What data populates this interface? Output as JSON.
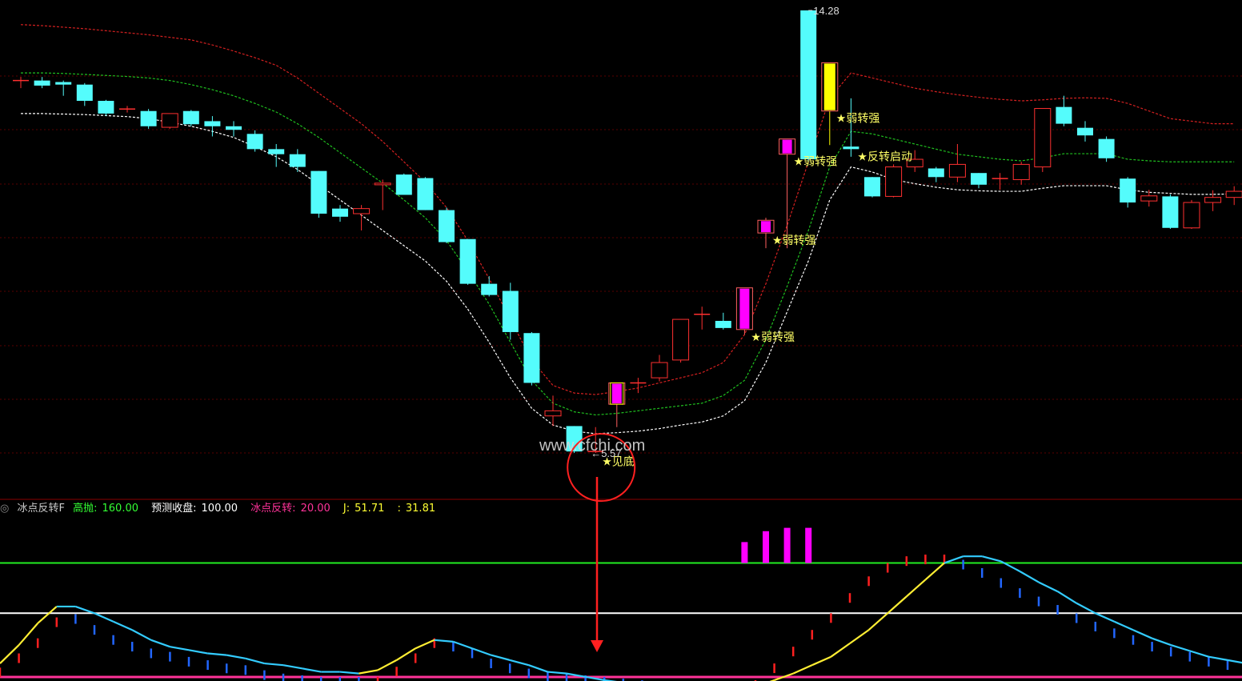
{
  "watermark": "www.cfchi.com",
  "indicator": {
    "name": "冰点反转F",
    "items": [
      {
        "label": "高抛:",
        "value": "160.00",
        "label_color": "#33ff33",
        "value_color": "#33ff33"
      },
      {
        "label": "预测收盘:",
        "value": "100.00",
        "label_color": "#ffffff",
        "value_color": "#ffffff"
      },
      {
        "label": "冰点反转:",
        "value": "20.00",
        "label_color": "#ff3399",
        "value_color": "#ff3399"
      },
      {
        "label": "J:",
        "value": "51.71",
        "label_color": "#ffff33",
        "value_color": "#ffff33"
      },
      {
        "label": ":",
        "value": "31.81",
        "label_color": "#ffff33",
        "value_color": "#ffff33"
      }
    ]
  },
  "colors": {
    "up": "#ff3030",
    "down": "#54fcfc",
    "signal": "#ff00ff",
    "yellow": "#ffff00",
    "env_red": "#d42020",
    "env_green": "#1fbf1f",
    "env_white": "#ffffff",
    "label": "#ffff66",
    "line_high": "#22ee22",
    "line_mid": "#ffffff",
    "line_low": "#ff3399",
    "j_down": "#33ccff",
    "j_up": "#ffee33"
  },
  "chart_data": {
    "type": "candlestick",
    "price_high_label": "14.28",
    "price_low_label": "5.57",
    "ylim": [
      5.0,
      14.5
    ],
    "candles": [
      {
        "o": 12.9,
        "h": 12.97,
        "l": 12.75,
        "c": 12.9,
        "t": "doji"
      },
      {
        "o": 12.9,
        "h": 12.97,
        "l": 12.75,
        "c": 12.8,
        "t": "down"
      },
      {
        "o": 12.87,
        "h": 12.9,
        "l": 12.6,
        "c": 12.82,
        "t": "down"
      },
      {
        "o": 12.82,
        "h": 12.85,
        "l": 12.4,
        "c": 12.5,
        "t": "down"
      },
      {
        "o": 12.5,
        "h": 12.52,
        "l": 12.2,
        "c": 12.25,
        "t": "down"
      },
      {
        "o": 12.34,
        "h": 12.4,
        "l": 12.27,
        "c": 12.34,
        "t": "doji"
      },
      {
        "o": 12.3,
        "h": 12.34,
        "l": 11.95,
        "c": 12.0,
        "t": "down"
      },
      {
        "o": 11.98,
        "h": 12.25,
        "l": 11.95,
        "c": 12.25,
        "t": "up"
      },
      {
        "o": 12.3,
        "h": 12.32,
        "l": 12.0,
        "c": 12.04,
        "t": "down"
      },
      {
        "o": 12.1,
        "h": 12.2,
        "l": 11.8,
        "c": 12.0,
        "t": "down"
      },
      {
        "o": 12.0,
        "h": 12.1,
        "l": 11.8,
        "c": 11.93,
        "t": "down"
      },
      {
        "o": 11.85,
        "h": 11.92,
        "l": 11.5,
        "c": 11.55,
        "t": "down"
      },
      {
        "o": 11.55,
        "h": 11.65,
        "l": 11.2,
        "c": 11.45,
        "t": "down"
      },
      {
        "o": 11.45,
        "h": 11.55,
        "l": 11.1,
        "c": 11.2,
        "t": "down"
      },
      {
        "o": 11.12,
        "h": 11.12,
        "l": 10.2,
        "c": 10.28,
        "t": "down"
      },
      {
        "o": 10.38,
        "h": 10.45,
        "l": 10.12,
        "c": 10.22,
        "t": "down"
      },
      {
        "o": 10.28,
        "h": 10.45,
        "l": 9.95,
        "c": 10.38,
        "t": "up"
      },
      {
        "o": 10.88,
        "h": 10.95,
        "l": 10.35,
        "c": 10.88,
        "t": "up"
      },
      {
        "o": 11.05,
        "h": 11.07,
        "l": 10.65,
        "c": 10.65,
        "t": "down"
      },
      {
        "o": 10.98,
        "h": 11.0,
        "l": 10.35,
        "c": 10.35,
        "t": "down"
      },
      {
        "o": 10.35,
        "h": 10.4,
        "l": 9.7,
        "c": 9.72,
        "t": "down"
      },
      {
        "o": 9.78,
        "h": 9.78,
        "l": 8.88,
        "c": 8.9,
        "t": "down"
      },
      {
        "o": 8.9,
        "h": 9.05,
        "l": 8.65,
        "c": 8.68,
        "t": "down"
      },
      {
        "o": 8.76,
        "h": 8.92,
        "l": 7.8,
        "c": 7.95,
        "t": "down"
      },
      {
        "o": 7.93,
        "h": 7.95,
        "l": 6.9,
        "c": 6.95,
        "t": "down"
      },
      {
        "o": 6.3,
        "h": 6.7,
        "l": 6.1,
        "c": 6.4,
        "t": "up"
      },
      {
        "o": 6.1,
        "h": 6.1,
        "l": 5.57,
        "c": 5.6,
        "t": "down"
      },
      {
        "o": 5.55,
        "h": 6.08,
        "l": 5.57,
        "c": 5.6,
        "t": "doji"
      },
      {
        "o": 6.53,
        "h": 6.95,
        "l": 6.08,
        "c": 6.95,
        "t": "signal"
      },
      {
        "o": 6.9,
        "h": 7.05,
        "l": 6.75,
        "c": 6.95,
        "t": "doji"
      },
      {
        "o": 7.05,
        "h": 7.5,
        "l": 6.98,
        "c": 7.35,
        "t": "up"
      },
      {
        "o": 7.4,
        "h": 8.2,
        "l": 7.35,
        "c": 8.2,
        "t": "up"
      },
      {
        "o": 8.3,
        "h": 8.45,
        "l": 8.0,
        "c": 8.3,
        "t": "doji"
      },
      {
        "o": 8.17,
        "h": 8.33,
        "l": 8.0,
        "c": 8.03,
        "t": "down"
      },
      {
        "o": 8.0,
        "h": 8.82,
        "l": 7.9,
        "c": 8.82,
        "t": "signal"
      },
      {
        "o": 9.9,
        "h": 10.2,
        "l": 9.6,
        "c": 10.15,
        "t": "signal"
      },
      {
        "o": 11.45,
        "h": 11.55,
        "l": 9.6,
        "c": 11.75,
        "t": "signal"
      },
      {
        "o": 14.28,
        "h": 14.28,
        "l": 11.3,
        "c": 11.35,
        "t": "down"
      },
      {
        "o": 12.3,
        "h": 13.25,
        "l": 11.63,
        "c": 13.25,
        "t": "yellow"
      },
      {
        "o": 11.55,
        "h": 12.55,
        "l": 11.4,
        "c": 11.6,
        "t": "down"
      },
      {
        "o": 11.0,
        "h": 11.0,
        "l": 10.6,
        "c": 10.62,
        "t": "down"
      },
      {
        "o": 10.62,
        "h": 11.25,
        "l": 10.6,
        "c": 11.2,
        "t": "up"
      },
      {
        "o": 11.2,
        "h": 11.53,
        "l": 11.1,
        "c": 11.35,
        "t": "up"
      },
      {
        "o": 11.17,
        "h": 11.2,
        "l": 10.9,
        "c": 11.0,
        "t": "down"
      },
      {
        "o": 11.0,
        "h": 11.65,
        "l": 10.9,
        "c": 11.25,
        "t": "up"
      },
      {
        "o": 11.08,
        "h": 11.08,
        "l": 10.78,
        "c": 10.85,
        "t": "down"
      },
      {
        "o": 10.97,
        "h": 11.08,
        "l": 10.75,
        "c": 10.97,
        "t": "doji"
      },
      {
        "o": 10.95,
        "h": 11.3,
        "l": 10.85,
        "c": 11.25,
        "t": "up"
      },
      {
        "o": 11.2,
        "h": 12.35,
        "l": 11.1,
        "c": 12.35,
        "t": "up"
      },
      {
        "o": 12.38,
        "h": 12.6,
        "l": 12.0,
        "c": 12.05,
        "t": "down"
      },
      {
        "o": 11.97,
        "h": 12.1,
        "l": 11.7,
        "c": 11.82,
        "t": "down"
      },
      {
        "o": 11.75,
        "h": 11.8,
        "l": 11.3,
        "c": 11.37,
        "t": "down"
      },
      {
        "o": 10.97,
        "h": 11.0,
        "l": 10.4,
        "c": 10.5,
        "t": "down"
      },
      {
        "o": 10.53,
        "h": 10.75,
        "l": 10.42,
        "c": 10.63,
        "t": "up"
      },
      {
        "o": 10.62,
        "h": 10.66,
        "l": 9.98,
        "c": 10.0,
        "t": "down"
      },
      {
        "o": 10.0,
        "h": 10.55,
        "l": 9.98,
        "c": 10.5,
        "t": "up"
      },
      {
        "o": 10.5,
        "h": 10.74,
        "l": 10.33,
        "c": 10.6,
        "t": "up"
      },
      {
        "o": 10.6,
        "h": 10.82,
        "l": 10.45,
        "c": 10.72,
        "t": "up"
      }
    ],
    "ma_white": [
      12.25,
      12.25,
      12.24,
      12.23,
      12.21,
      12.19,
      12.15,
      12.08,
      12.0,
      11.9,
      11.78,
      11.6,
      11.4,
      11.15,
      10.85,
      10.55,
      10.25,
      9.95,
      9.65,
      9.35,
      8.95,
      8.4,
      7.75,
      7.05,
      6.45,
      6.12,
      6.0,
      5.95,
      5.97,
      6.0,
      6.05,
      6.12,
      6.18,
      6.3,
      6.6,
      7.35,
      8.35,
      9.35,
      10.55,
      11.2,
      11.1,
      10.95,
      10.87,
      10.8,
      10.75,
      10.73,
      10.72,
      10.72,
      10.78,
      10.83,
      10.83,
      10.83,
      10.75,
      10.7,
      10.68,
      10.66,
      10.66,
      10.67
    ],
    "ma_green": [
      13.05,
      13.05,
      13.04,
      13.02,
      13.0,
      12.98,
      12.95,
      12.9,
      12.82,
      12.72,
      12.6,
      12.45,
      12.28,
      12.05,
      11.78,
      11.48,
      11.18,
      10.88,
      10.55,
      10.2,
      9.75,
      9.15,
      8.5,
      7.75,
      7.0,
      6.55,
      6.38,
      6.32,
      6.35,
      6.4,
      6.45,
      6.5,
      6.55,
      6.7,
      7.0,
      7.8,
      8.85,
      9.95,
      11.2,
      11.9,
      11.85,
      11.75,
      11.65,
      11.55,
      11.45,
      11.4,
      11.35,
      11.32,
      11.38,
      11.46,
      11.46,
      11.46,
      11.35,
      11.32,
      11.3,
      11.3,
      11.3,
      11.3
    ],
    "ma_red": [
      14.0,
      13.98,
      13.95,
      13.92,
      13.88,
      13.84,
      13.8,
      13.75,
      13.7,
      13.6,
      13.48,
      13.35,
      13.2,
      12.95,
      12.65,
      12.35,
      12.05,
      11.7,
      11.3,
      10.9,
      10.4,
      9.75,
      9.0,
      8.2,
      7.4,
      6.9,
      6.75,
      6.72,
      6.78,
      6.85,
      6.95,
      7.05,
      7.15,
      7.35,
      7.9,
      8.9,
      10.05,
      11.3,
      12.55,
      13.05,
      12.95,
      12.85,
      12.75,
      12.68,
      12.62,
      12.57,
      12.53,
      12.5,
      12.52,
      12.55,
      12.56,
      12.55,
      12.45,
      12.3,
      12.15,
      12.1,
      12.05,
      12.05
    ],
    "annotations": [
      {
        "index": 27,
        "text": "见底",
        "circled": true
      },
      {
        "index": 34,
        "text": "弱转强"
      },
      {
        "index": 35,
        "text": "弱转强"
      },
      {
        "index": 36,
        "text": "弱转强"
      },
      {
        "index": 38,
        "text": "弱转强"
      },
      {
        "index": 39,
        "text": "反转启动"
      }
    ],
    "indicator_levels": {
      "high": 160,
      "mid": 100,
      "low": 20
    },
    "indicator_ylim": [
      20,
      215
    ],
    "j_line": [
      40,
      62,
      88,
      108,
      108,
      100,
      90,
      80,
      68,
      60,
      56,
      52,
      50,
      46,
      40,
      38,
      34,
      30,
      30,
      28,
      32,
      44,
      58,
      68,
      66,
      58,
      50,
      44,
      38,
      30,
      28,
      24,
      20,
      17,
      16,
      14,
      12,
      10,
      8,
      8,
      12,
      20,
      28,
      38,
      48,
      64,
      80,
      100,
      120,
      140,
      160,
      168,
      168,
      162,
      150,
      137,
      126,
      112,
      100,
      90,
      80,
      70,
      62,
      55,
      48,
      44,
      40
    ],
    "j_colors": [
      "up",
      "up",
      "up",
      "up",
      "down",
      "down",
      "down",
      "down",
      "down",
      "down",
      "down",
      "down",
      "down",
      "down",
      "down",
      "down",
      "down",
      "down",
      "down",
      "down",
      "up",
      "up",
      "up",
      "up",
      "down",
      "down",
      "down",
      "down",
      "down",
      "down",
      "down",
      "down",
      "down",
      "down",
      "down",
      "down",
      "down",
      "down",
      "up",
      "up",
      "up",
      "up",
      "up",
      "up",
      "up",
      "up",
      "up",
      "up",
      "up",
      "up",
      "up",
      "down",
      "down",
      "down",
      "down",
      "down",
      "down",
      "down",
      "down",
      "down",
      "down",
      "down",
      "down",
      "down",
      "down",
      "down",
      "down"
    ],
    "stems": [
      35,
      52,
      70,
      95,
      95,
      82,
      70,
      62,
      54,
      50,
      44,
      40,
      36,
      34,
      28,
      24,
      22,
      20,
      20,
      20,
      24,
      36,
      52,
      70,
      62,
      54,
      42,
      36,
      30,
      26,
      24,
      22,
      20,
      18,
      16,
      14,
      12,
      12,
      12,
      12,
      20,
      40,
      60,
      80,
      100,
      124,
      144,
      160,
      168,
      170,
      170,
      160,
      150,
      138,
      126,
      116,
      106,
      96,
      86,
      78,
      70,
      62,
      56,
      50,
      44,
      40,
      36
    ],
    "signal_bars": [
      {
        "index": 34,
        "value": 185
      },
      {
        "index": 35,
        "value": 198
      },
      {
        "index": 36,
        "value": 202
      },
      {
        "index": 37,
        "value": 202
      }
    ]
  }
}
